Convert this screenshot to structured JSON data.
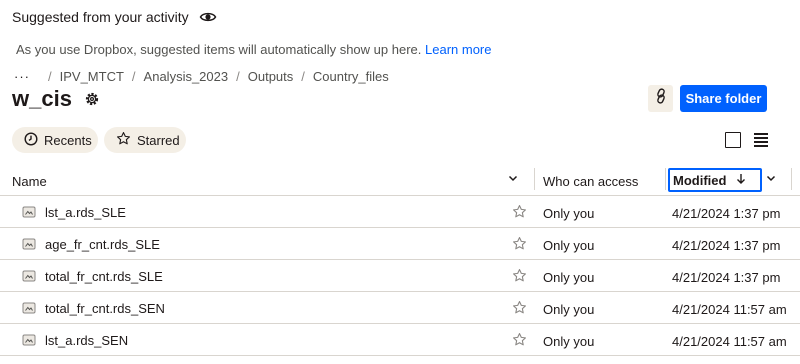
{
  "suggested": {
    "heading": "Suggested from your activity",
    "description": "As you use Dropbox, suggested items will automatically show up here.",
    "learn_more": "Learn more"
  },
  "breadcrumb": {
    "more": "···",
    "separator": "/",
    "items": [
      "IPV_MTCT",
      "Analysis_2023",
      "Outputs",
      "Country_files"
    ]
  },
  "folder": {
    "title": "w_cis",
    "share_button": "Share folder"
  },
  "filters": {
    "recents": "Recents",
    "starred": "Starred"
  },
  "columns": {
    "name": "Name",
    "who_can_access": "Who can access",
    "modified": "Modified"
  },
  "files": [
    {
      "name": "lst_a.rds_SLE",
      "access": "Only you",
      "modified": "4/21/2024 1:37 pm"
    },
    {
      "name": "age_fr_cnt.rds_SLE",
      "access": "Only you",
      "modified": "4/21/2024 1:37 pm"
    },
    {
      "name": "total_fr_cnt.rds_SLE",
      "access": "Only you",
      "modified": "4/21/2024 1:37 pm"
    },
    {
      "name": "total_fr_cnt.rds_SEN",
      "access": "Only you",
      "modified": "4/21/2024 11:57 am"
    },
    {
      "name": "lst_a.rds_SEN",
      "access": "Only you",
      "modified": "4/21/2024 11:57 am"
    }
  ],
  "colors": {
    "accent": "#0061fe",
    "chip_bg": "#f4efe6",
    "text": "#1e1919",
    "divider": "#d9d5cf"
  },
  "icons": {
    "suggested": "eye-icon",
    "settings": "gear-icon",
    "copy_link": "link-icon",
    "recents": "clock-icon",
    "starred": "star-outline-icon",
    "grid_view": "square-view-icon",
    "list_view": "list-view-icon",
    "file": "file-icon",
    "sort": "arrow-down-icon",
    "menu": "chevron-down-icon"
  }
}
